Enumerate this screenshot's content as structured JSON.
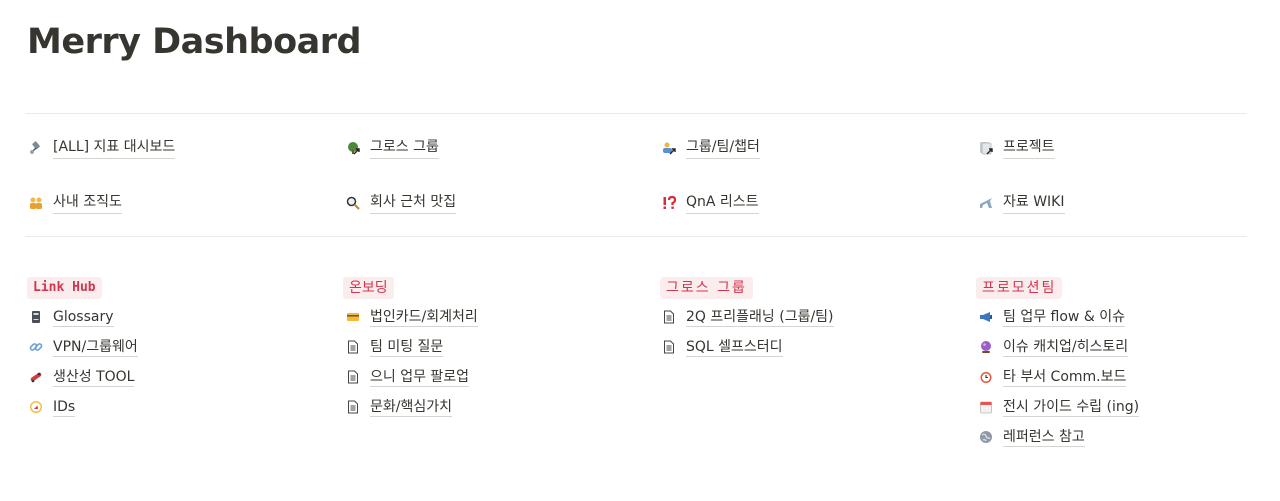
{
  "page": {
    "title": "Merry Dashboard"
  },
  "top_links": [
    {
      "label": "[ALL] 지표 대시보드",
      "icon": "satellite-icon"
    },
    {
      "label": "그로스 그룹",
      "icon": "tree-link-icon"
    },
    {
      "label": "그룹/팀/챕터",
      "icon": "users-link-icon"
    },
    {
      "label": "프로젝트",
      "icon": "document-link-icon"
    },
    {
      "label": "사내 조직도",
      "icon": "people-icon"
    },
    {
      "label": "회사 근처 맛집",
      "icon": "magnifier-icon"
    },
    {
      "label": "QnA 리스트",
      "icon": "exclamation-question-icon"
    },
    {
      "label": "자료 WIKI",
      "icon": "airplane-icon"
    }
  ],
  "columns": [
    {
      "heading": "Link Hub",
      "items": [
        {
          "label": "Glossary",
          "icon": "book-icon"
        },
        {
          "label": "VPN/그룹웨어",
          "icon": "link-icon"
        },
        {
          "label": "생산성 TOOL",
          "icon": "skateboard-icon"
        },
        {
          "label": "IDs",
          "icon": "compass-icon"
        }
      ]
    },
    {
      "heading": "온보딩",
      "items": [
        {
          "label": "법인카드/회계처리",
          "icon": "credit-card-icon"
        },
        {
          "label": "팀 미팅 질문",
          "icon": "page-icon"
        },
        {
          "label": "으니 업무 팔로업",
          "icon": "page-icon"
        },
        {
          "label": "문화/핵심가치",
          "icon": "page-icon"
        }
      ]
    },
    {
      "heading": "그로스 그룹",
      "items": [
        {
          "label": "2Q 프리플래닝 (그룹/팀)",
          "icon": "page-icon"
        },
        {
          "label": "SQL 셀프스터디",
          "icon": "page-icon"
        }
      ]
    },
    {
      "heading": "프로모션팀",
      "items": [
        {
          "label": "팀 업무 flow & 이슈",
          "icon": "megaphone-icon"
        },
        {
          "label": "이슈 캐치업/히스토리",
          "icon": "crystal-ball-icon"
        },
        {
          "label": "타 부서 Comm.보드",
          "icon": "alarm-clock-icon"
        },
        {
          "label": "전시 가이드 수립 (ing)",
          "icon": "calendar-icon"
        },
        {
          "label": "레퍼런스 참고",
          "icon": "globe-icon"
        }
      ]
    }
  ],
  "colors": {
    "heading_bg": "#fbecee",
    "heading_text": "#d2364d",
    "text": "#37352f"
  }
}
